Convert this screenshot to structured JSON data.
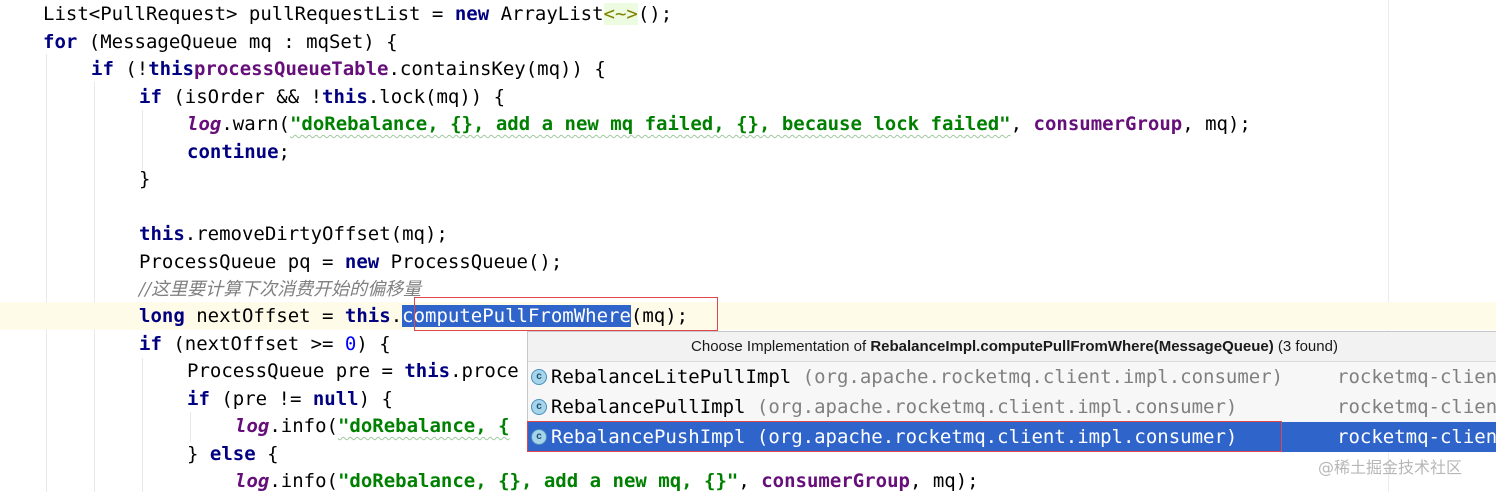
{
  "code": {
    "l1": {
      "a": "List<PullRequest> pullRequestList = ",
      "kw": "new",
      "b": " ArrayList",
      "gen": "<~>",
      "c": "();"
    },
    "l2": {
      "kw": "for",
      "a": " (MessageQueue mq : mqSet) {"
    },
    "l3": {
      "kw": "if",
      "a": " (!",
      "this": "this",
      ".": ".",
      "fld": "processQueueTable",
      "b": ".containsKey(mq)) {"
    },
    "l4": {
      "kw": "if",
      "a": " (isOrder && !",
      "this": "this",
      "b": ".lock(mq)) {"
    },
    "l5": {
      "log": "log",
      "a": ".warn(",
      "str": "\"doRebalance, {}, add a new mq failed, {}, because lock failed\"",
      "b": ", ",
      "fld": "consumerGroup",
      "c": ", mq);"
    },
    "l6": {
      "kw": "continue",
      "a": ";"
    },
    "l7": {
      "a": "}"
    },
    "l9": {
      "this": "this",
      "a": ".removeDirtyOffset(mq);"
    },
    "l10": {
      "a": "ProcessQueue pq = ",
      "kw": "new",
      "b": " ProcessQueue();"
    },
    "l11": {
      "cmt": "//这里要计算下次消费开始的偏移量"
    },
    "l12": {
      "kw": "long",
      "a": " nextOffset = ",
      "this": "this",
      "b": ".",
      "sel": "computePullFromWhere",
      "c": "(mq);"
    },
    "l13": {
      "kw": "if",
      "a": " (nextOffset >= ",
      "num": "0",
      "b": ") {"
    },
    "l14": {
      "a": "ProcessQueue pre = ",
      "this": "this",
      "b": ".proce"
    },
    "l15": {
      "kw": "if",
      "a": " (pre != ",
      "nul": "null",
      "b": ") {"
    },
    "l16": {
      "log": "log",
      "a": ".info(",
      "str": "\"doRebalance, {"
    },
    "l17": {
      "a": "} ",
      "kw": "else",
      "b": " {"
    },
    "l18": {
      "log": "log",
      "a": ".info(",
      "str": "\"doRebalance, {}, add a new mq, {}\"",
      "b": ", ",
      "fld": "consumerGroup",
      "c": ", mq);"
    }
  },
  "popup": {
    "title_prefix": "Choose Implementation of ",
    "title_bold": "RebalanceImpl.computePullFromWhere(MessageQueue)",
    "title_suffix": " (3 found)",
    "icon_letter": "c",
    "items": [
      {
        "name": "RebalanceLitePullImpl",
        "package": " (org.apache.rocketmq.client.impl.consumer)",
        "module": "rocketmq-client"
      },
      {
        "name": "RebalancePullImpl",
        "package": " (org.apache.rocketmq.client.impl.consumer)",
        "module": "rocketmq-client"
      },
      {
        "name": "RebalancePushImpl",
        "package": " (org.apache.rocketmq.client.impl.consumer)",
        "module": "rocketmq-client"
      }
    ],
    "selected_index": 2
  },
  "watermark": "@稀土掘金技术社区",
  "colors": {
    "keyword": "#000080",
    "field": "#660e7a",
    "string": "#008000",
    "selection": "#2f65ca",
    "highlight_box": "#e0474c"
  }
}
